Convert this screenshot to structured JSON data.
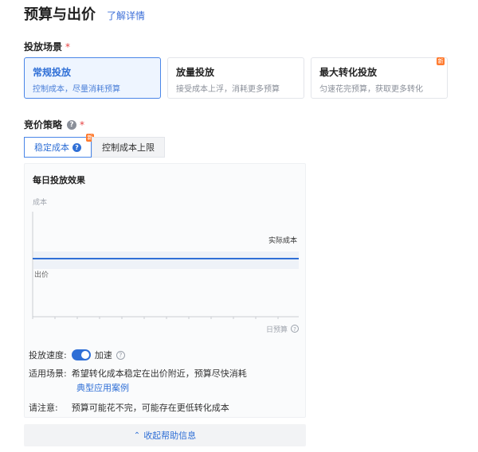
{
  "header": {
    "title": "预算与出价",
    "learn_more": "了解详情"
  },
  "placement_scene": {
    "label": "投放场景",
    "required_mark": "*",
    "options": [
      {
        "title": "常规投放",
        "desc": "控制成本，尽量消耗预算",
        "selected": true
      },
      {
        "title": "放量投放",
        "desc": "接受成本上浮，消耗更多预算",
        "selected": false
      },
      {
        "title": "最大转化投放",
        "desc": "匀速花完预算，获取更多转化",
        "selected": false,
        "badge": "新"
      }
    ]
  },
  "bid_strategy": {
    "label": "竞价策略",
    "required_mark": "*",
    "tabs": [
      {
        "label": "稳定成本",
        "selected": true,
        "badge": "新"
      },
      {
        "label": "控制成本上限",
        "selected": false
      }
    ]
  },
  "help_panel": {
    "chart_title": "每日投放效果",
    "chart_data": {
      "type": "line",
      "title": "",
      "ylabel": "成本",
      "xlabel": "日预算",
      "series": [
        {
          "name": "实际成本",
          "values": [
            1,
            1
          ]
        }
      ],
      "bid_label": "出价",
      "grid": false
    },
    "speed_label": "投放速度:",
    "speed_value": "加速",
    "speed_on": true,
    "scenario_label": "适用场景:",
    "scenario_text": "希望转化成本稳定在出价附近，预算尽快消耗",
    "case_link": "典型应用案例",
    "note_label": "请注意:",
    "note_text": "预算可能花不完，可能存在更低转化成本",
    "collapse": "收起帮助信息"
  },
  "colors": {
    "accent": "#2f6fd6",
    "badge": "#ff7a2e",
    "required": "#e64242"
  }
}
